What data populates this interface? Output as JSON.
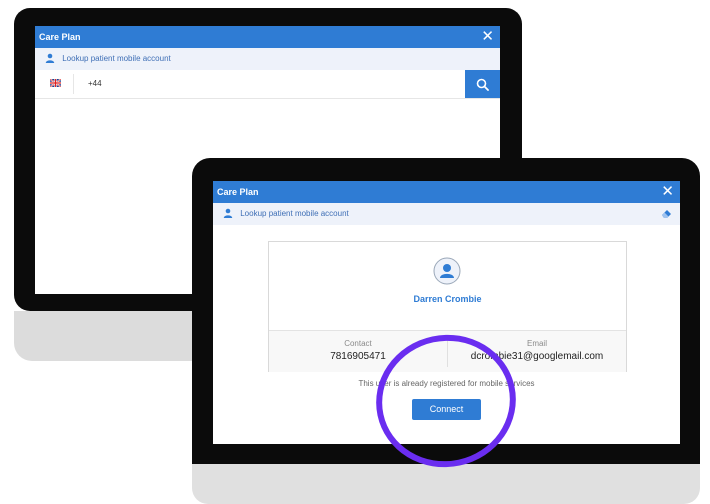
{
  "back_window": {
    "title": "Care Plan",
    "close_label": "✕",
    "lookup_label": "Lookup patient mobile account",
    "phone_prefix": "+44"
  },
  "front_window": {
    "title": "Care Plan",
    "close_label": "✕",
    "lookup_label": "Lookup patient mobile account",
    "patient": {
      "name": "Darren Crombie",
      "contact_label": "Contact",
      "contact_value": "7816905471",
      "email_label": "Email",
      "email_value": "dcrombie31@googlemail.com"
    },
    "registered_message": "This user is already registered for mobile services",
    "connect_label": "Connect"
  },
  "colors": {
    "accent": "#2f7cd4",
    "lookup_bar_bg": "#eef2fa",
    "annotation": "#6a2df0"
  },
  "icons": {
    "user": "user-icon",
    "search": "search-icon",
    "close": "close-icon",
    "eraser": "eraser-icon",
    "flag": "uk-flag-icon",
    "avatar": "avatar-icon"
  }
}
